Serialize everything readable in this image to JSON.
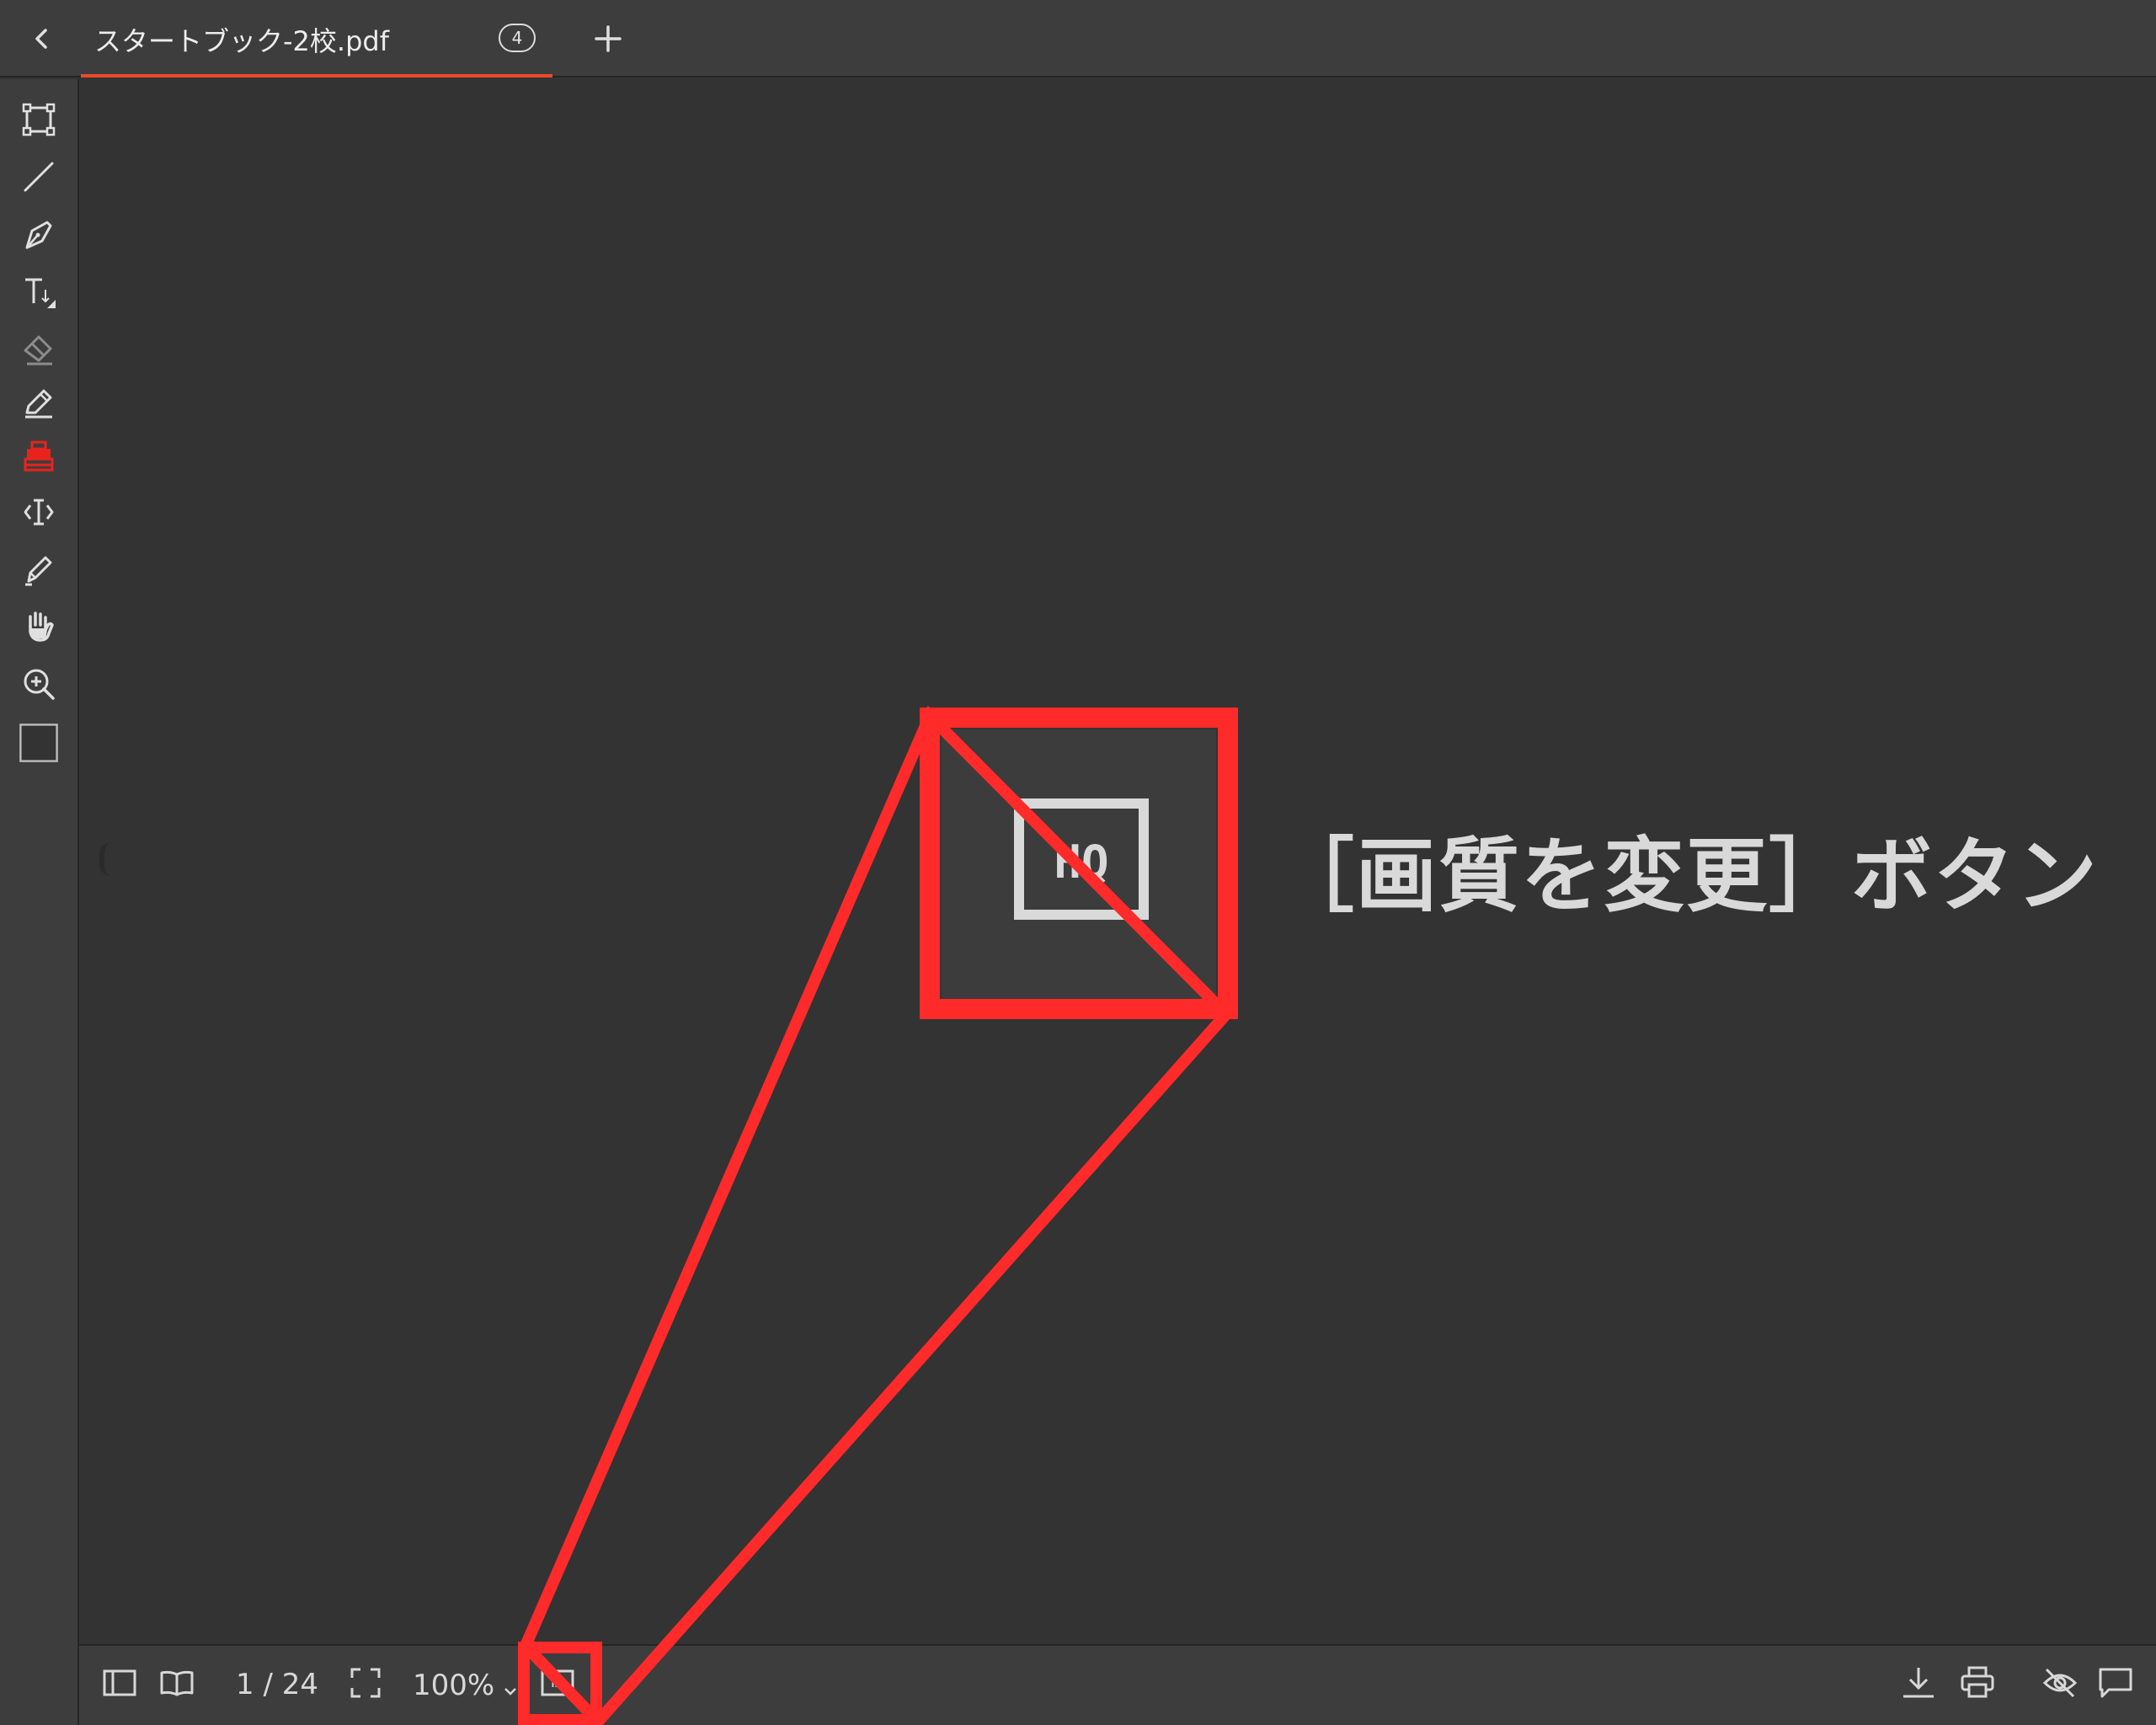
{
  "tab": {
    "title": "スタートブック-2校.pdf",
    "count": "4"
  },
  "toolbar": {
    "tools": [
      "rectangle-tool",
      "line-tool",
      "pen-tool",
      "text-tool",
      "eraser-tool",
      "annotate-pencil-tool",
      "stamp-tool",
      "text-select-tool",
      "highlighter-tool",
      "hand-tool",
      "zoom-tool",
      "color-swatch"
    ],
    "active_color": "#e8231e"
  },
  "bottombar": {
    "page_indicator": "1 / 24",
    "zoom": "100%"
  },
  "callout": {
    "icon_label": "HQ",
    "label": "［画質を変更］ボタン",
    "color": "#ff2a2a"
  },
  "colors": {
    "background": "#333333",
    "panel": "#3d3d3d",
    "tab_accent": "#ec4a28"
  }
}
